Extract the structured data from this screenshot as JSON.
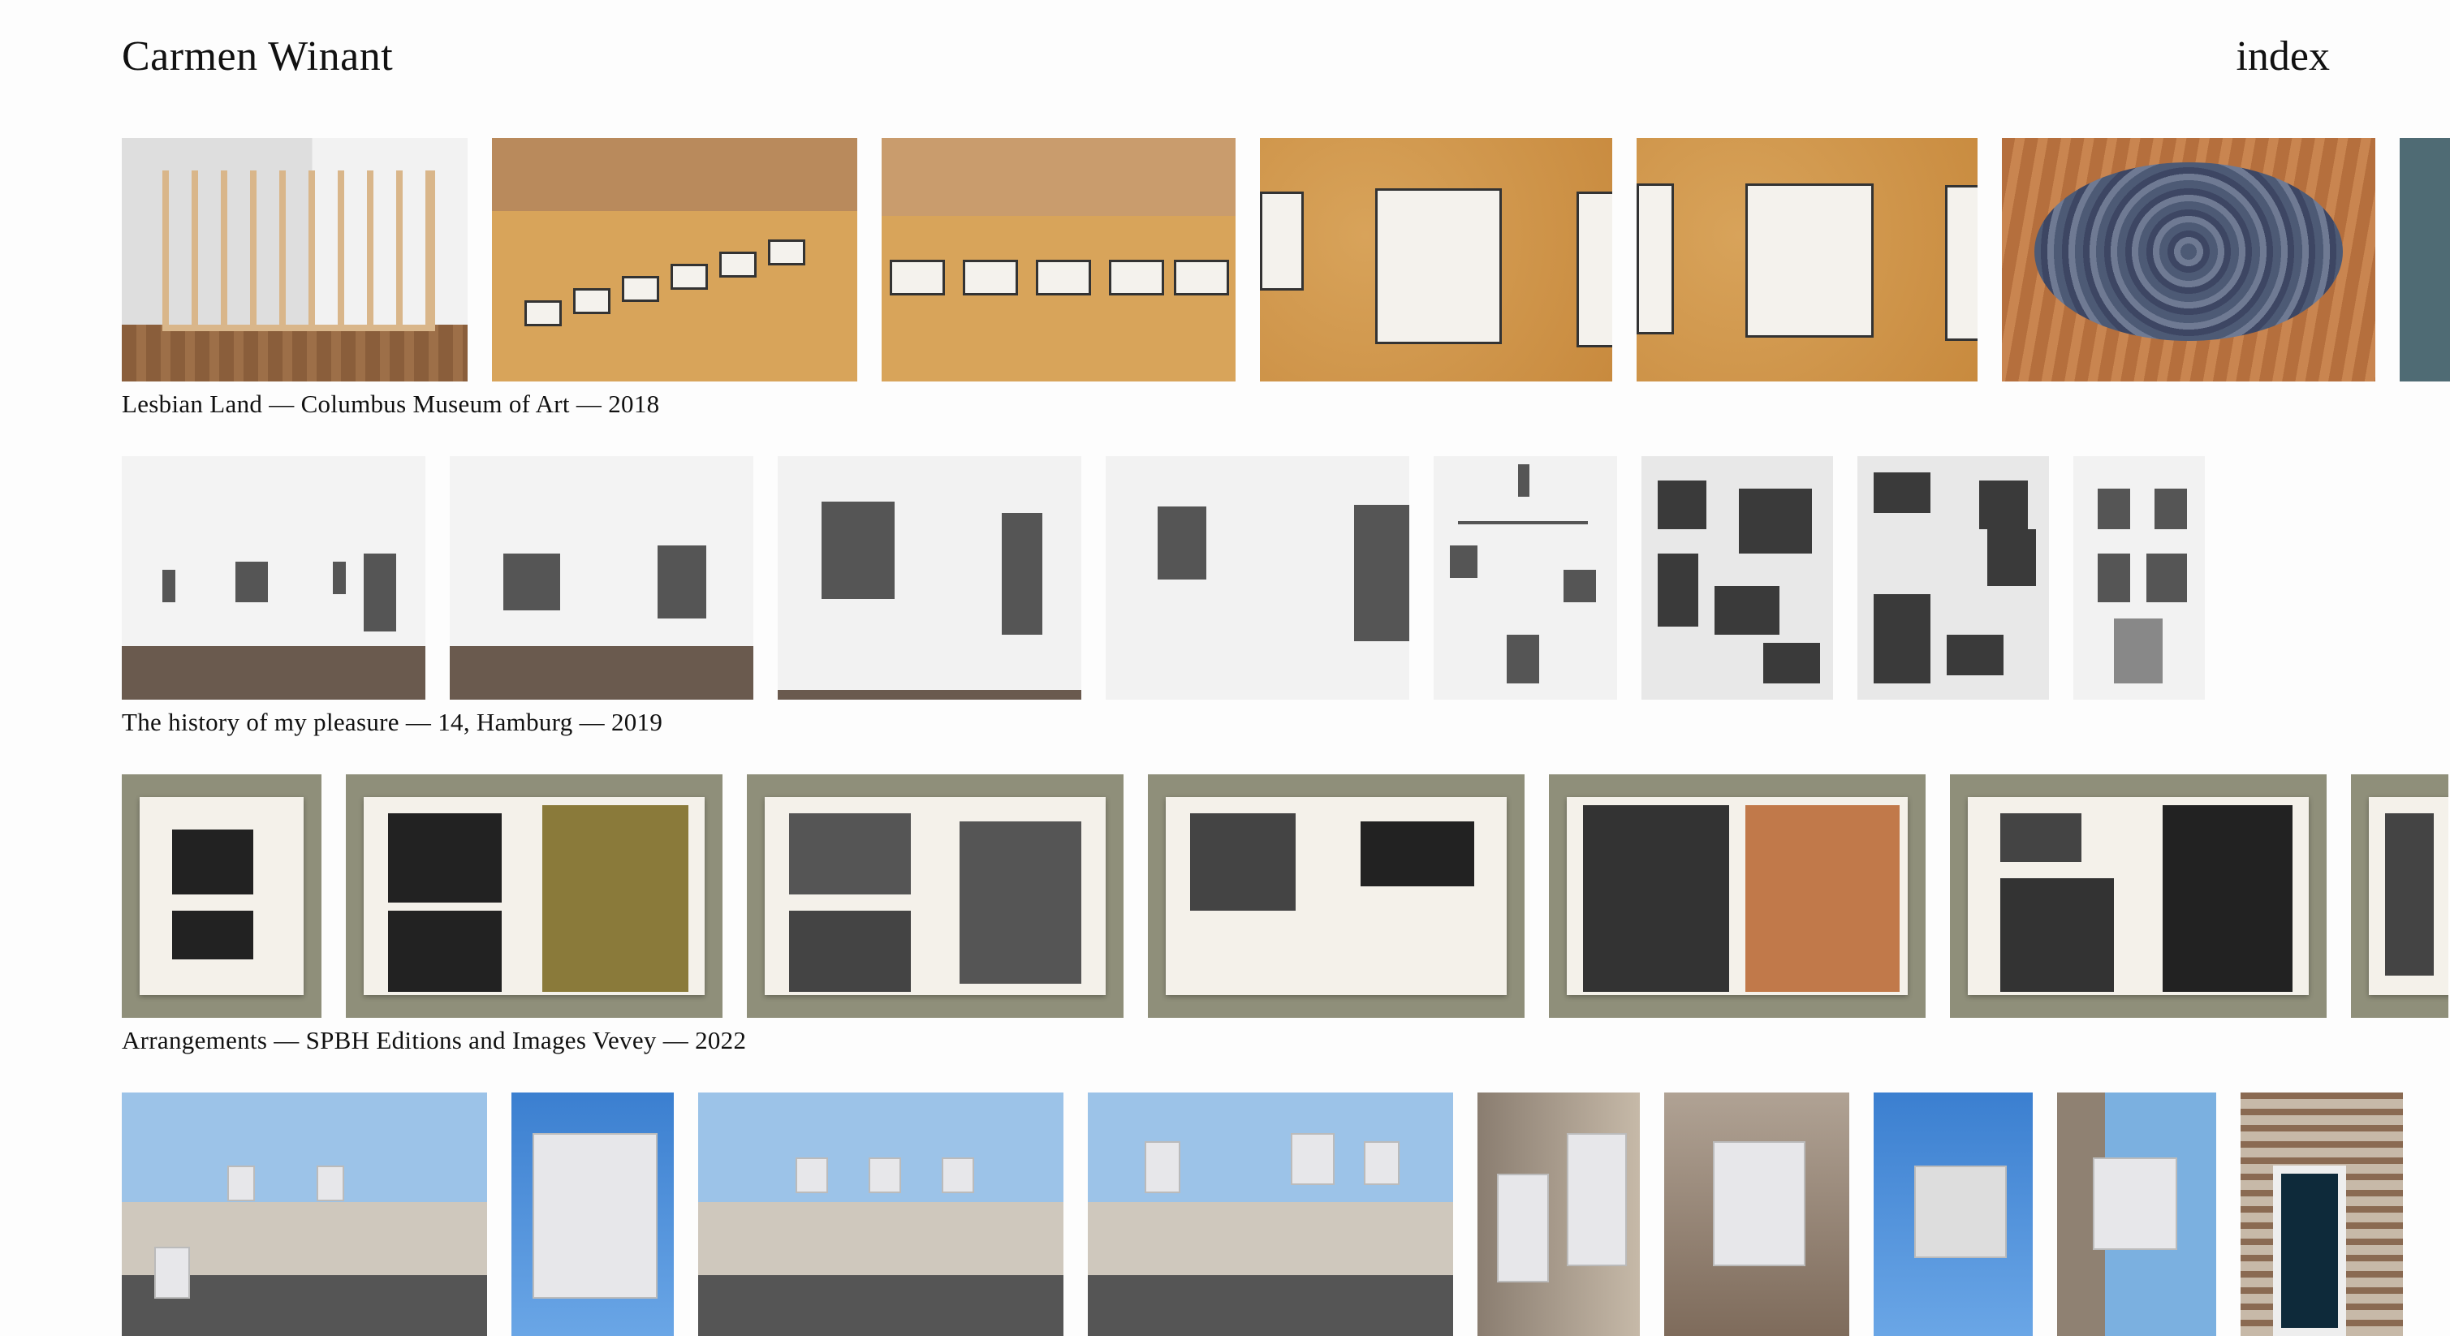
{
  "site": {
    "title": "Carmen Winant",
    "index_label": "index"
  },
  "projects": [
    {
      "caption": "Lesbian Land — Columbus Museum of Art — 2018"
    },
    {
      "caption": "The history of my pleasure — 14, Hamburg — 2019"
    },
    {
      "caption": "Arrangements — SPBH Editions and Images Vevey — 2022"
    }
  ]
}
